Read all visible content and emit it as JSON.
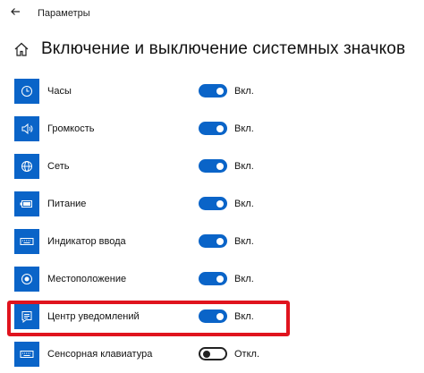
{
  "window": {
    "title": "Параметры"
  },
  "page": {
    "title": "Включение и выключение системных значков"
  },
  "accent": "#0a64c8",
  "highlight_color": "#e0141e",
  "icons": [
    {
      "name": "clock-icon",
      "label": "Часы",
      "state": "Вкл.",
      "on": true
    },
    {
      "name": "volume-icon",
      "label": "Громкость",
      "state": "Вкл.",
      "on": true
    },
    {
      "name": "network-icon",
      "label": "Сеть",
      "state": "Вкл.",
      "on": true
    },
    {
      "name": "battery-icon",
      "label": "Питание",
      "state": "Вкл.",
      "on": true
    },
    {
      "name": "keyboard-icon",
      "label": "Индикатор ввода",
      "state": "Вкл.",
      "on": true
    },
    {
      "name": "location-icon",
      "label": "Местоположение",
      "state": "Вкл.",
      "on": true
    },
    {
      "name": "notification-icon",
      "label": "Центр уведомлений",
      "state": "Вкл.",
      "on": true
    },
    {
      "name": "touch-keyboard-icon",
      "label": "Сенсорная клавиатура",
      "state": "Откл.",
      "on": false
    }
  ]
}
